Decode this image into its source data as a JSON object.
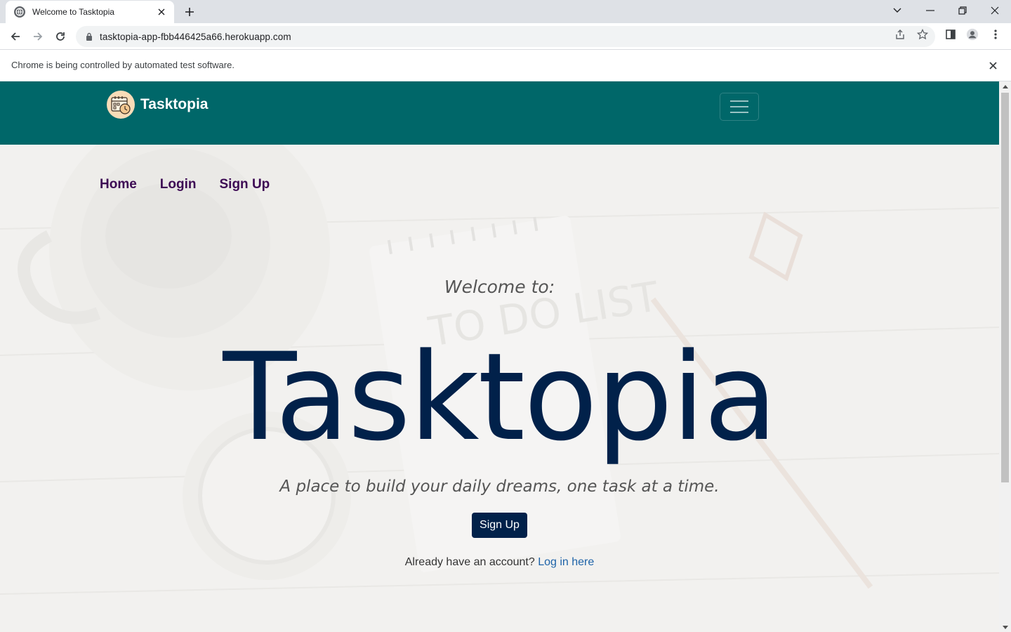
{
  "browser": {
    "tab_title": "Welcome to Tasktopia",
    "url": "tasktopia-app-fbb446425a66.herokuapp.com",
    "infobar_message": "Chrome is being controlled by automated test software."
  },
  "navbar": {
    "brand_name": "Tasktopia",
    "background_color": "#006769"
  },
  "nav_links": [
    {
      "label": "Home"
    },
    {
      "label": "Login"
    },
    {
      "label": "Sign Up"
    }
  ],
  "hero": {
    "welcome": "Welcome to:",
    "title": "Tasktopia",
    "tagline": "A place to build your daily dreams, one task at a time.",
    "signup_button": "Sign Up",
    "already_text": "Already have an account?",
    "login_link": "Log in here",
    "title_color": "#01214a",
    "link_color": "#3d0a54"
  }
}
